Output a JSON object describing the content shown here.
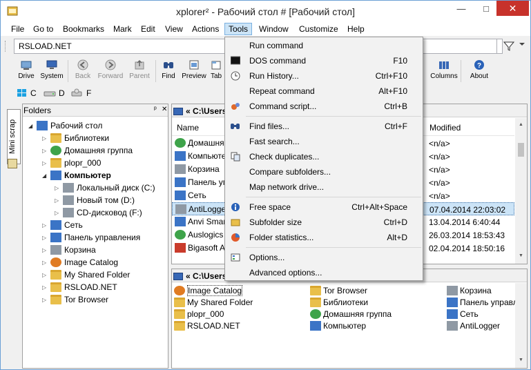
{
  "window": {
    "title": "xplorer² - Рабочий стол # [Рабочий стол]",
    "min_glyph": "—",
    "max_glyph": "□",
    "close_glyph": "✕",
    "colors": {
      "accent": "#cce4f7",
      "close": "#c7322b",
      "border": "#6b9fd5"
    }
  },
  "menu": {
    "items": [
      "File",
      "Go to",
      "Bookmarks",
      "Mark",
      "Edit",
      "View",
      "Actions",
      "Tools",
      "Window",
      "Customize",
      "Help"
    ],
    "open_item": "Tools"
  },
  "address": {
    "value": "RSLOAD.NET"
  },
  "toolbar": {
    "buttons": [
      {
        "label": "Drive",
        "icon": "drive-icon",
        "enabled": true
      },
      {
        "label": "System",
        "icon": "system-icon",
        "enabled": true
      },
      {
        "label": "Back",
        "icon": "back-icon",
        "enabled": false
      },
      {
        "label": "Forward",
        "icon": "forward-icon",
        "enabled": false
      },
      {
        "label": "Parent",
        "icon": "parent-icon",
        "enabled": false
      },
      {
        "label": "Find",
        "icon": "find-icon",
        "enabled": true
      },
      {
        "label": "Preview",
        "icon": "preview-icon",
        "enabled": true
      },
      {
        "label": "Tab",
        "icon": "tab-icon",
        "enabled": true
      },
      {
        "label": "Columns",
        "icon": "columns-icon",
        "enabled": true
      },
      {
        "label": "About",
        "icon": "about-icon",
        "enabled": true
      }
    ]
  },
  "drives": [
    "C",
    "D",
    "F"
  ],
  "side_tab": {
    "label": "Mini scrap"
  },
  "folders_panel": {
    "title": "Folders",
    "pin_glyph": "ᵖ",
    "close_glyph": "✕",
    "tree": [
      {
        "label": "Рабочий стол",
        "icon": "desktop-icon",
        "bold": false
      },
      {
        "label": "Библиотеки",
        "icon": "libraries-icon",
        "bold": false
      },
      {
        "label": "Домашняя группа",
        "icon": "homegroup-icon",
        "bold": false
      },
      {
        "label": "plopr_000",
        "icon": "user-folder-icon",
        "bold": false
      },
      {
        "label": "Компьютер",
        "icon": "computer-icon",
        "bold": true
      },
      {
        "label": "Локальный диск (C:)",
        "icon": "local-disk-icon",
        "bold": false
      },
      {
        "label": "Новый том (D:)",
        "icon": "disk-icon",
        "bold": false
      },
      {
        "label": "CD-дисковод (F:)",
        "icon": "cd-drive-icon",
        "bold": false
      },
      {
        "label": "Сеть",
        "icon": "network-icon",
        "bold": false
      },
      {
        "label": "Панель управления",
        "icon": "control-panel-icon",
        "bold": false
      },
      {
        "label": "Корзина",
        "icon": "recycle-bin-icon",
        "bold": false
      },
      {
        "label": "Image Catalog",
        "icon": "image-catalog-icon",
        "bold": false
      },
      {
        "label": "My Shared Folder",
        "icon": "folder-icon",
        "bold": false
      },
      {
        "label": "RSLOAD.NET",
        "icon": "folder-icon",
        "bold": false
      },
      {
        "label": "Tor Browser",
        "icon": "folder-icon",
        "bold": false
      }
    ]
  },
  "top_pane": {
    "path": "« C:\\Users\\",
    "columns": {
      "name": "Name",
      "modified": "Modified"
    },
    "rows": [
      {
        "name": "Домашня",
        "modified": "<n/a>",
        "icon": "homegroup-icon",
        "selected": false
      },
      {
        "name": "Компьюте",
        "modified": "<n/a>",
        "icon": "computer-icon",
        "selected": false
      },
      {
        "name": "Корзина",
        "modified": "<n/a>",
        "icon": "recycle-bin-icon",
        "selected": false
      },
      {
        "name": "Панель упр",
        "modified": "<n/a>",
        "icon": "control-panel-icon",
        "selected": false
      },
      {
        "name": "Сеть",
        "modified": "<n/a>",
        "icon": "network-icon",
        "selected": false
      },
      {
        "name": "AntiLogge",
        "modified": "07.04.2014 22:03:02",
        "icon": "app-icon",
        "selected": true
      },
      {
        "name": "Anvi Smar",
        "modified": "13.04.2014 6:40:44",
        "icon": "app-icon",
        "selected": false
      },
      {
        "name": "Auslogics",
        "modified": "26.03.2014 18:53:43",
        "icon": "app-icon",
        "selected": false
      },
      {
        "name": "Bigasoft A",
        "modified": "02.04.2014 18:50:16",
        "icon": "app-icon",
        "selected": false
      }
    ]
  },
  "bottom_pane": {
    "path": "« C:\\Users\\",
    "col1": [
      "Image Catalog",
      "My Shared Folder",
      "plopr_000",
      "RSLOAD.NET"
    ],
    "col2": [
      "Tor Browser",
      "Библиотеки",
      "Домашняя группа",
      "Компьютер"
    ],
    "col3": [
      "Корзина",
      "Панель управлен",
      "Сеть",
      "AntiLogger"
    ]
  },
  "tools_menu": {
    "items": [
      {
        "label": "Run command",
        "shortcut": "",
        "icon": "run-command-icon"
      },
      {
        "label": "DOS command",
        "shortcut": "F10",
        "icon": "dos-icon"
      },
      {
        "label": "Run History...",
        "shortcut": "Ctrl+F10",
        "icon": "history-icon"
      },
      {
        "label": "Repeat command",
        "shortcut": "Alt+F10",
        "icon": ""
      },
      {
        "label": "Command script...",
        "shortcut": "Ctrl+B",
        "icon": "script-icon"
      },
      {
        "label": "Find files...",
        "shortcut": "Ctrl+F",
        "icon": "find-icon"
      },
      {
        "label": "Fast search...",
        "shortcut": "",
        "icon": ""
      },
      {
        "label": "Check duplicates...",
        "shortcut": "",
        "icon": "duplicates-icon"
      },
      {
        "label": "Compare subfolders...",
        "shortcut": "",
        "icon": ""
      },
      {
        "label": "Map network drive...",
        "shortcut": "",
        "icon": ""
      },
      {
        "label": "Free space",
        "shortcut": "Ctrl+Alt+Space",
        "icon": "info-icon"
      },
      {
        "label": "Subfolder size",
        "shortcut": "Ctrl+D",
        "icon": "subfolder-size-icon"
      },
      {
        "label": "Folder statistics...",
        "shortcut": "Alt+D",
        "icon": "pie-chart-icon"
      },
      {
        "label": "Options...",
        "shortcut": "",
        "icon": "options-icon"
      },
      {
        "label": "Advanced options...",
        "shortcut": "",
        "icon": ""
      }
    ]
  }
}
